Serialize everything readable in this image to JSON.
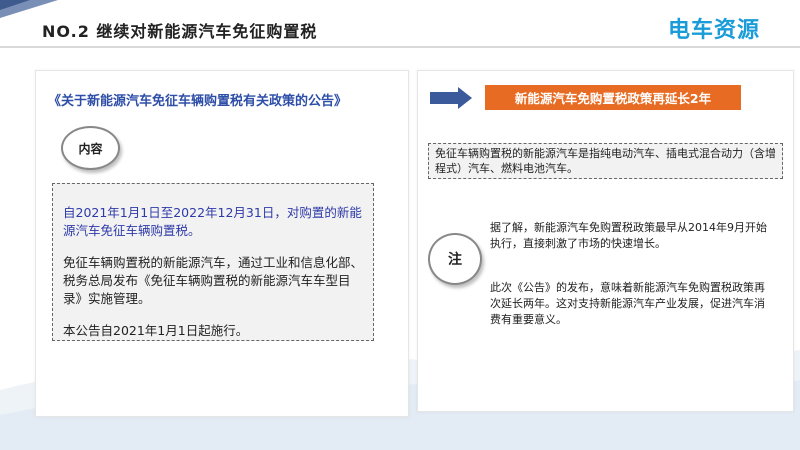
{
  "header": {
    "title": "NO.2  继续对新能源汽车免征购置税",
    "logo_text": "电车资源"
  },
  "left": {
    "document_title": "《关于新能源汽车免征车辆购置税有关政策的公告》",
    "content_label": "内容",
    "paragraphs": [
      "自2021年1月1日至2022年12月31日，对购置的新能源汽车免征车辆购置税。",
      "免征车辆购置税的新能源汽车，通过工业和信息化部、税务总局发布《免征车辆购置税的新能源汽车车型目录》实施管理。",
      "本公告自2021年1月1日起施行。"
    ]
  },
  "right": {
    "badge": "新能源汽车免购置税政策再延长2年",
    "definition": "免征车辆购置税的新能源汽车是指纯电动汽车、插电式混合动力（含增程式）汽车、燃料电池汽车。",
    "note_label": "注",
    "notes": [
      "据了解，新能源汽车免购置税政策最早从2014年9月开始执行，直接刺激了市场的快速增长。",
      "此次《公告》的发布，意味着新能源汽车免购置税政策再次延长两年。这对支持新能源汽车产业发展，促进汽车消费有重要意义。"
    ]
  },
  "colors": {
    "accent_blue": "#2e4fa8",
    "badge_orange": "#e76b22",
    "logo_blue": "#1a9cd8"
  }
}
